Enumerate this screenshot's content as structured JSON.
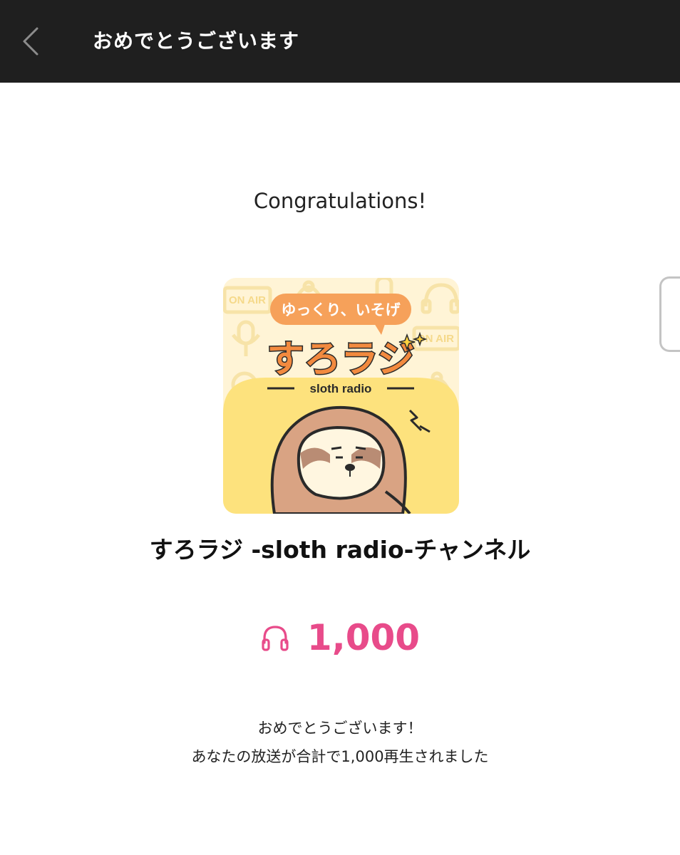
{
  "header": {
    "title": "おめでとうございます",
    "back_icon": "chevron-left-icon"
  },
  "main": {
    "heading": "Congratulations!",
    "artwork": {
      "bubble_text": "ゆっくり、いそげ",
      "logo_text": "すろラジ",
      "logo_subtitle": "sloth radio",
      "on_air_text": "ON AIR",
      "on_air_text_2": "ON AIR",
      "colors": {
        "background": "#fff4d6",
        "hill": "#fde27d",
        "bubble": "#f6a15a",
        "logo": "#f28a3f",
        "sloth": "#d9a383"
      }
    },
    "channel_name": "すろラジ -sloth radio-チャンネル",
    "plays": {
      "icon": "headphones-icon",
      "count": "1,000",
      "color": "#e84b8a"
    },
    "message": {
      "line1": "おめでとうございます！",
      "line2": "あなたの放送が合計で1,000再生されました"
    }
  }
}
